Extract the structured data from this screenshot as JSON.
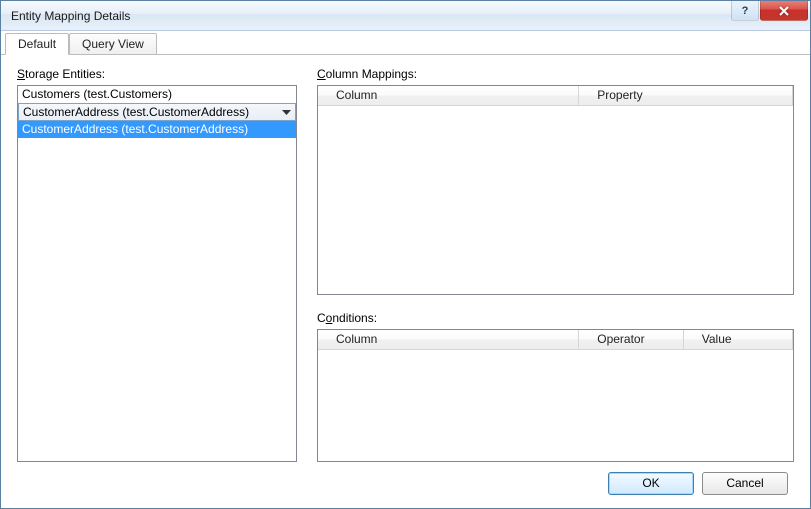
{
  "window": {
    "title": "Entity Mapping Details"
  },
  "tabs": {
    "default": "Default",
    "queryview": "Query View"
  },
  "left": {
    "label_pre": "",
    "label_ul": "S",
    "label_post": "torage Entities:",
    "items": [
      "Customers (test.Customers)",
      "CustomerAddress (test.CustomerAddress)",
      "CustomerAddress (test.CustomerAddress)"
    ]
  },
  "right": {
    "mappings": {
      "label_pre": "",
      "label_ul": "C",
      "label_post": "olumn Mappings:",
      "columns": {
        "col1": "Column",
        "col2": "Property"
      }
    },
    "conditions": {
      "label_pre": "C",
      "label_ul": "o",
      "label_post": "nditions:",
      "columns": {
        "col1": "Column",
        "col2": "Operator",
        "col3": "Value"
      }
    }
  },
  "buttons": {
    "ok": "OK",
    "cancel": "Cancel"
  }
}
